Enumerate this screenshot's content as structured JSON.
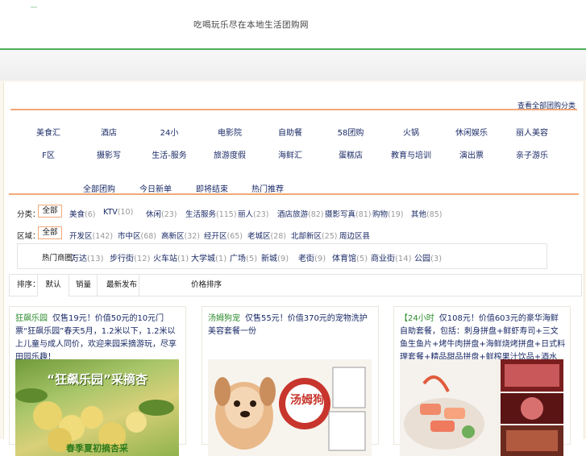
{
  "header": {
    "slogan": "吃喝玩乐尽在本地生活团购网"
  },
  "panel": {
    "top_right_link": "查看全部团购分类"
  },
  "categories": {
    "row1": [
      "美食汇",
      "酒店",
      "24小",
      "电影院",
      "自助餐",
      "58团购",
      "火锅",
      "休闲娱乐",
      "丽人美容"
    ],
    "row2": [
      "F区",
      "摄影写",
      "生活-服务",
      "旅游度假",
      "海鲜汇",
      "蛋糕店",
      "教育与培训",
      "演出票",
      "亲子游乐"
    ]
  },
  "tabs": [
    "全部团购",
    "今日新单",
    "即将结束",
    "热门推荐"
  ],
  "filters": {
    "row1": {
      "label": "分类：",
      "selected": "全部",
      "options": [
        {
          "name": "美食",
          "count": "(6)"
        },
        {
          "name": "KTV",
          "count": "(10)"
        },
        {
          "name": "休闲",
          "count": "(23)"
        },
        {
          "name": "生活服务",
          "count": "(115)"
        },
        {
          "name": "丽人",
          "count": "(23)"
        },
        {
          "name": "酒店旅游",
          "count": "(82)"
        },
        {
          "name": "摄影写真",
          "count": "(81)"
        },
        {
          "name": "购物",
          "count": "(19)"
        },
        {
          "name": "其他",
          "count": "(85)"
        }
      ]
    },
    "row2": {
      "label": "区域：",
      "selected": "全部",
      "options": [
        {
          "name": "开发区",
          "count": "(142)"
        },
        {
          "name": "市中区",
          "count": "(68)"
        },
        {
          "name": "高新区",
          "count": "(32)"
        },
        {
          "name": "经开区",
          "count": "(65)"
        },
        {
          "name": "老城区",
          "count": "(28)"
        },
        {
          "name": "北部新区",
          "count": "(25)"
        },
        {
          "name": "周边区县",
          "count": ""
        }
      ]
    },
    "sub": {
      "label": "热门商圈：",
      "options": [
        {
          "name": "万达",
          "count": "(13)"
        },
        {
          "name": "步行街",
          "count": "(12)"
        },
        {
          "name": "火车站",
          "count": "(1)"
        },
        {
          "name": "大学城",
          "count": "(1)"
        },
        {
          "name": "广场",
          "count": "(5)"
        },
        {
          "name": "新城",
          "count": "(9)"
        },
        {
          "name": "老街",
          "count": "(9)"
        },
        {
          "name": "体育馆",
          "count": "(5)"
        },
        {
          "name": "商业街",
          "count": "(14)"
        },
        {
          "name": "公园",
          "count": "(3)"
        }
      ]
    }
  },
  "sortbar": {
    "label": "排序：",
    "items": [
      "默认",
      "销量",
      "最新发布",
      "价格排序"
    ]
  },
  "deals": [
    {
      "tag": "狂飙乐园",
      "text": "仅售19元！价值50元的10元门票“狂飙乐园”春天5月，1.2米以下，1.2米以上儿童与成人同价，欢迎来园采摘游玩，尽享田园乐趣！",
      "image_caption": "“狂飙乐园”采摘杏",
      "image_subcaption": "春季夏初摘杏采"
    },
    {
      "tag": "汤姆狗宠",
      "text": "仅售55元！价值370元的宠物洗护美容套餐一份",
      "image_caption": "汤姆狗",
      "image_subcaption": ""
    },
    {
      "tag": "【24小时",
      "text": "仅108元！价值603元的豪华海鲜自助套餐，包括：刺身拼盘+鲜虾寿司+三文鱼生鱼片+烤牛肉拼盘+海鲜烧烤拼盘+日式料理套餐+精品甜品拼盘+鲜榨果汁饮品+酒水",
      "image_caption": "",
      "image_subcaption": ""
    }
  ],
  "colors": {
    "green_accent": "#4cae5b",
    "orange_accent": "#f2a978",
    "link_blue": "#1a2a66"
  }
}
